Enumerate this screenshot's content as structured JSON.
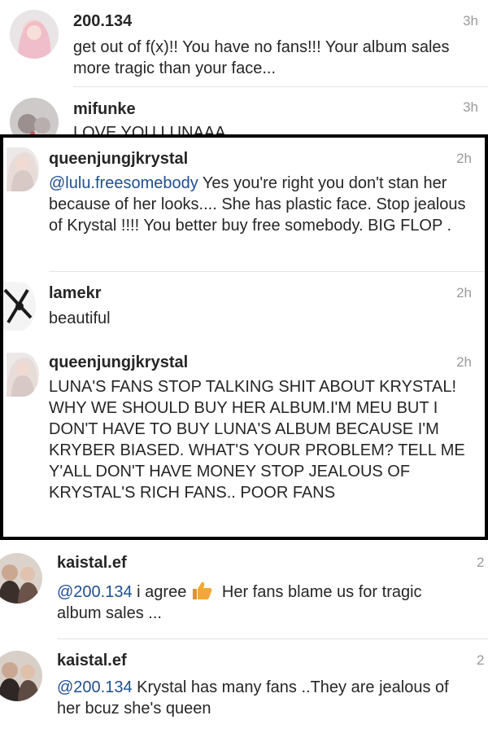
{
  "comments_top": [
    {
      "username": "200.134",
      "time": "3h",
      "text": "get out of f(x)!! You have no fans!!! Your album sales more tragic than your face..."
    },
    {
      "username": "mifunke",
      "time": "3h",
      "text": "LOVE YOU LUNAAA"
    }
  ],
  "framed_comments": [
    {
      "username": "queenjungjkrystal",
      "time": "2h",
      "mention": "@lulu.freesomebody",
      "text": " Yes you're right you don't stan her because of her looks.... She has plastic face. Stop jealous of Krystal !!!! You better buy free somebody. BIG FLOP ."
    },
    {
      "username": "lamekr",
      "time": "2h",
      "text": "beautiful"
    },
    {
      "username": "queenjungjkrystal",
      "time": "2h",
      "text": "LUNA'S FANS STOP TALKING SHIT ABOUT KRYSTAL! WHY WE SHOULD BUY HER ALBUM.I'M MEU BUT I DON'T HAVE TO BUY LUNA'S ALBUM BECAUSE I'M KRYBER BIASED. WHAT'S YOUR PROBLEM? TELL ME Y'ALL DON'T HAVE MONEY STOP JEALOUS OF KRYSTAL'S RICH FANS.. POOR FANS"
    }
  ],
  "comments_bottom": [
    {
      "username": "kaistal.ef",
      "time": "2",
      "mention": "@200.134",
      "text_before_emoji": " i agree",
      "emoji": "thumbs-up-icon",
      "text_after_emoji": " Her fans blame us for tragic album sales ..."
    },
    {
      "username": "kaistal.ef",
      "time": "2",
      "mention": "@200.134",
      "text": " Krystal has many fans ..They are jealous of her bcuz she's queen"
    }
  ],
  "colors": {
    "mention": "#1f4f8f",
    "username": "#262626",
    "timestamp": "#9a9a9a",
    "frame_border": "#000000",
    "thumbs_up": "#f3a63a"
  }
}
